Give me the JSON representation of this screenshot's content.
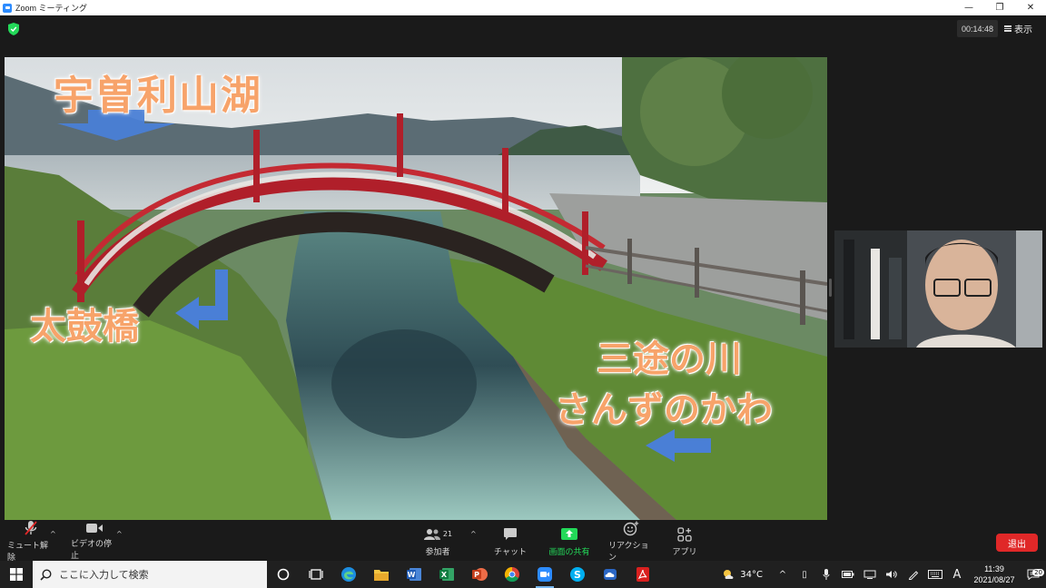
{
  "window": {
    "title": "Zoom ミーティング",
    "minimize": "—",
    "restore": "❐",
    "close": "✕"
  },
  "meeting": {
    "timer": "00:14:48",
    "view_label": "表示"
  },
  "shared_content": {
    "lake_label": "宇曽利山湖",
    "bridge_label": "太鼓橋",
    "river_label": "三途の川",
    "river_reading": "さんずのかわ"
  },
  "toolbar": {
    "mute_label": "ミュート解除",
    "video_label": "ビデオの停止",
    "participants_label": "参加者",
    "participants_count": "21",
    "chat_label": "チャット",
    "share_label": "画面の共有",
    "reactions_label": "リアクション",
    "apps_label": "アプリ",
    "leave_label": "退出"
  },
  "taskbar": {
    "search_placeholder": "ここに入力して検索",
    "temperature": "34°C",
    "ime": "A",
    "time": "11:39",
    "date": "2021/08/27",
    "notification_count": "20"
  },
  "colors": {
    "share_green": "#23d959",
    "leave_red": "#e02828",
    "overlay_orange": "#f7a36a",
    "arrow_blue": "#4a7fd6"
  }
}
